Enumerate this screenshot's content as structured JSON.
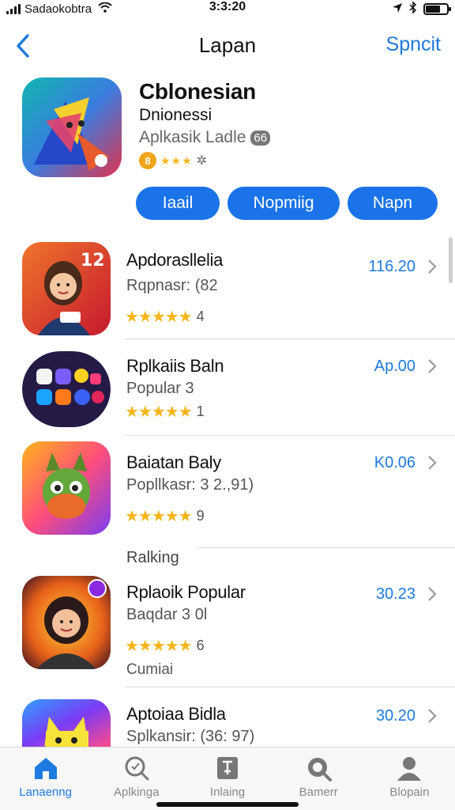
{
  "status_bar": {
    "carrier": "Sadaokobtra",
    "time": "3:3:20"
  },
  "nav": {
    "title": "Lapan",
    "action": "Spncit"
  },
  "featured": {
    "title": "Cblonesian",
    "subtitle": "Dnionessi",
    "category": "Aplkasik Ladle",
    "badge": "66",
    "rating_circle": "8",
    "buttons": [
      "Iaail",
      "Nopmiig",
      "Napn"
    ]
  },
  "apps": [
    {
      "title": "Apdorasllelia",
      "subtitle": "Rqpnasr: (82",
      "stars": "★★★★★",
      "count": "4",
      "price": "116.20"
    },
    {
      "title": "Rplkaiis Baln",
      "subtitle": "Popular 3    ",
      "stars": "★★★★★",
      "count": "1",
      "price": "Ap.00"
    },
    {
      "title": "Baiatan Baly",
      "subtitle": "Popllkasr: 3 2.,91)",
      "stars": "★★★★★",
      "count": "9",
      "price": "K0.06"
    },
    {
      "title": "Rplaoik Popular",
      "subtitle": "Baqdar 3 0l",
      "stars": "★★★★★",
      "count": "6",
      "price": "30.23"
    },
    {
      "title": "Aptoiaa Bidla",
      "subtitle": "Splkansir: (36: 97)",
      "stars": "",
      "count": "",
      "price": "30.20"
    }
  ],
  "section_label": "Ralking",
  "extra_label": "Cumiai",
  "tabs": [
    {
      "label": "Lanaenng",
      "icon": "home-icon",
      "active": true
    },
    {
      "label": "Aplkinga",
      "icon": "search-icon",
      "active": false
    },
    {
      "label": "Inlaing",
      "icon": "document-icon",
      "active": false
    },
    {
      "label": "Bamerr",
      "icon": "magnifier-icon",
      "active": false
    },
    {
      "label": "Blopain",
      "icon": "person-icon",
      "active": false
    }
  ],
  "colors": {
    "accent": "#1e7ae0",
    "pill": "#1a73e8",
    "star": "#f5b51a"
  }
}
